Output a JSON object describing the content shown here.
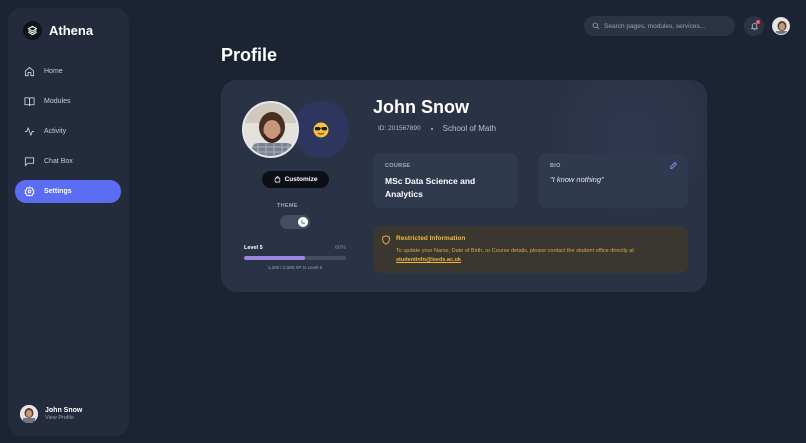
{
  "app": {
    "name": "Athena"
  },
  "sidebar": {
    "items": [
      {
        "label": "Home",
        "icon": "home-icon"
      },
      {
        "label": "Modules",
        "icon": "book-icon"
      },
      {
        "label": "Activity",
        "icon": "activity-icon"
      },
      {
        "label": "Chat Box",
        "icon": "chat-icon"
      },
      {
        "label": "Settings",
        "icon": "gear-icon",
        "active": true
      }
    ],
    "user": {
      "name": "John Snow",
      "link": "View Profile"
    }
  },
  "topbar": {
    "search_placeholder": "Search pages, modules, services...",
    "has_notification": true
  },
  "page": {
    "title": "Profile"
  },
  "profile": {
    "name": "John Snow",
    "id": "ID: 201567890",
    "school": "School of Math",
    "customize_label": "Customize",
    "theme_label": "THEME",
    "level": {
      "label": "Level 5",
      "percent_label": "60%",
      "progress": 0.6,
      "xp_text": "1,200 / 2,000 XP to Level 6"
    },
    "course": {
      "label": "COURSE",
      "value": "MSc Data Science and Analytics"
    },
    "bio": {
      "label": "BIO",
      "value": "\"I know nothing\""
    },
    "restricted": {
      "title": "Restricted Information",
      "text": "To update your Name, Date of Birth, or Course details, please contact the student office directly at",
      "email": "studentinfo@leeds.ac.uk",
      "suffix": "."
    }
  },
  "colors": {
    "accent": "#5b6df2",
    "warning": "#f2b83a",
    "background": "#1c2333",
    "card": "#2a3346"
  }
}
